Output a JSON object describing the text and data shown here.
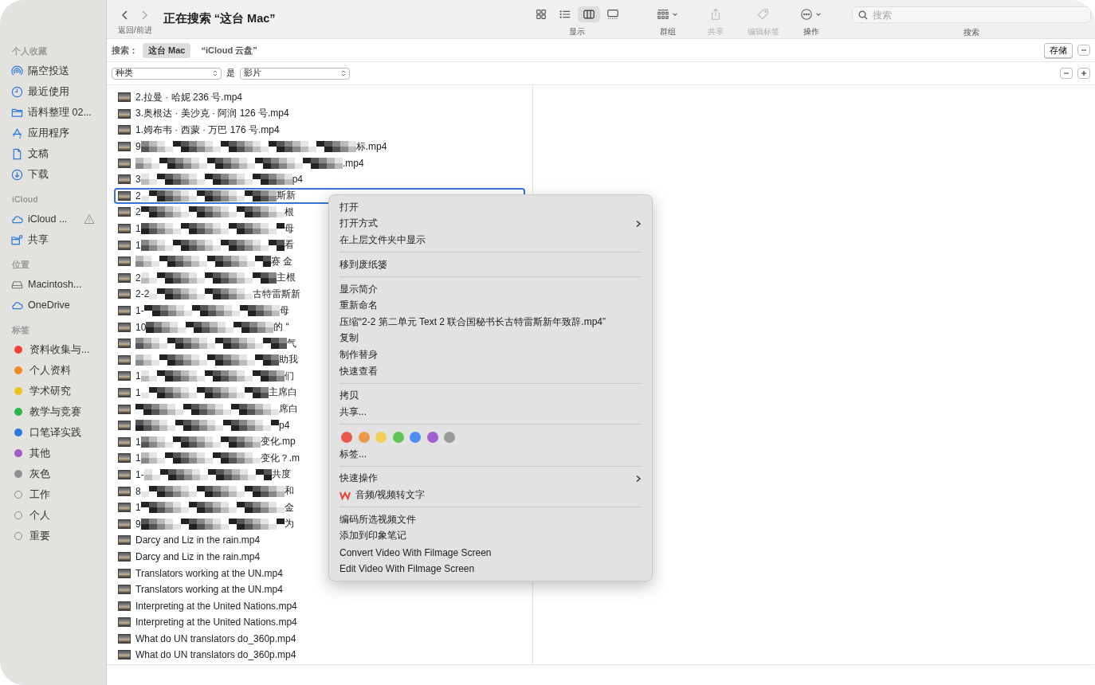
{
  "window": {
    "title": "正在搜索 “这台 Mac”",
    "nav_label": "返回/前进"
  },
  "sidebar": {
    "sections": [
      {
        "header": "个人收藏",
        "items": [
          {
            "label": "隔空投送",
            "warning": false
          },
          {
            "label": "最近使用",
            "warning": false
          },
          {
            "label": "语料整理 02...",
            "warning": false
          },
          {
            "label": "应用程序",
            "warning": false
          },
          {
            "label": "文稿",
            "warning": false
          },
          {
            "label": "下载",
            "warning": false
          }
        ]
      },
      {
        "header": "iCloud",
        "items": [
          {
            "label": "iCloud ...",
            "warning": true
          },
          {
            "label": "共享",
            "warning": false
          }
        ]
      },
      {
        "header": "位置",
        "items": [
          {
            "label": "Macintosh...",
            "warning": false
          },
          {
            "label": "OneDrive",
            "warning": false
          }
        ]
      },
      {
        "header": "标签",
        "items": [
          {
            "label": "资料收集与...",
            "color": "#f0443a"
          },
          {
            "label": "个人资料",
            "color": "#f08a24"
          },
          {
            "label": "学术研究",
            "color": "#e9c21c"
          },
          {
            "label": "教学与竞赛",
            "color": "#2fb449"
          },
          {
            "label": "口笔译实践",
            "color": "#2a7ae2"
          },
          {
            "label": "其他",
            "color": "#a45ac9"
          },
          {
            "label": "灰色",
            "color": "#8e8e93"
          },
          {
            "label": "工作"
          },
          {
            "label": "个人"
          },
          {
            "label": "重要"
          }
        ]
      }
    ]
  },
  "toolbar": {
    "view_buttons": [
      {
        "selected": false
      },
      {
        "selected": false
      },
      {
        "selected": true
      },
      {
        "selected": false
      }
    ],
    "view_label": "显示",
    "tools": [
      {
        "label": "群组",
        "disabled": false
      },
      {
        "label": "共享",
        "disabled": true
      },
      {
        "label": "编辑标签",
        "disabled": true
      },
      {
        "label": "操作",
        "disabled": false
      }
    ],
    "search": {
      "placeholder": "搜索",
      "label": "搜索"
    }
  },
  "scope_bar": {
    "label": "搜索：",
    "scopes": [
      {
        "label": "这台 Mac",
        "selected": true
      },
      {
        "label": "“iCloud 云盘”",
        "selected": false
      }
    ],
    "save_button": "存储"
  },
  "criteria": {
    "attribute": "种类",
    "operator": "是",
    "value": "影片"
  },
  "files": [
    {
      "kind": "plain",
      "name": "2.拉曼 · 哈妮 236 号.mp4",
      "selected": false
    },
    {
      "kind": "plain",
      "name": "3.奥根达 · 美沙克 · 阿润 126 号.mp4",
      "selected": false
    },
    {
      "kind": "plain",
      "name": "1.姆布韦 · 西蒙 · 万巴 176 号.mp4",
      "selected": false
    },
    {
      "kind": "pixelated",
      "prefix": "9",
      "suffix": "标.mp4",
      "selected": false
    },
    {
      "kind": "pixelated",
      "suffix": ".mp4",
      "selected": false
    },
    {
      "kind": "pixelated",
      "prefix": "3",
      "suffix": "p4",
      "selected": false
    },
    {
      "kind": "pixelated",
      "prefix": "2",
      "suffix": "斯新",
      "selected": true
    },
    {
      "kind": "pixelated",
      "prefix": "2",
      "suffix": "根",
      "selected": false
    },
    {
      "kind": "pixelated",
      "prefix": "1",
      "suffix": "母",
      "selected": false
    },
    {
      "kind": "pixelated",
      "prefix": "1",
      "suffix": "看",
      "selected": false
    },
    {
      "kind": "pixelated",
      "suffix": "赛 金",
      "selected": false
    },
    {
      "kind": "pixelated",
      "prefix": "2",
      "suffix": "主根",
      "selected": false
    },
    {
      "kind": "pixelated",
      "prefix": "2-2",
      "suffix": "古特雷斯新",
      "selected": false
    },
    {
      "kind": "pixelated",
      "prefix": "1-",
      "suffix": "母",
      "selected": false
    },
    {
      "kind": "pixelated",
      "prefix": "10",
      "suffix": "的 “",
      "selected": false
    },
    {
      "kind": "pixelated",
      "suffix": "气",
      "selected": false
    },
    {
      "kind": "pixelated",
      "suffix": "助我",
      "selected": false
    },
    {
      "kind": "pixelated",
      "prefix": "1",
      "suffix": "们",
      "selected": false
    },
    {
      "kind": "pixelated",
      "prefix": "1",
      "suffix": "主席白",
      "selected": false
    },
    {
      "kind": "pixelated",
      "suffix": "席白",
      "selected": false
    },
    {
      "kind": "pixelated",
      "suffix": "p4",
      "selected": false
    },
    {
      "kind": "pixelated",
      "prefix": "1",
      "suffix": "变化.mp",
      "selected": false
    },
    {
      "kind": "pixelated",
      "prefix": "1",
      "suffix": "变化？.m",
      "selected": false
    },
    {
      "kind": "pixelated",
      "prefix": "1-",
      "suffix": "共度",
      "selected": false
    },
    {
      "kind": "pixelated",
      "prefix": "8",
      "suffix": "和",
      "selected": false
    },
    {
      "kind": "pixelated",
      "prefix": "1",
      "suffix": "金",
      "selected": false
    },
    {
      "kind": "pixelated",
      "prefix": "9",
      "suffix": "为",
      "selected": false
    },
    {
      "kind": "plain",
      "name": "Darcy and Liz in the rain.mp4",
      "selected": false
    },
    {
      "kind": "plain",
      "name": "Darcy and Liz in the rain.mp4",
      "selected": false
    },
    {
      "kind": "plain",
      "name": "Translators working at the UN.mp4",
      "selected": false
    },
    {
      "kind": "plain",
      "name": "Translators working at the UN.mp4",
      "selected": false
    },
    {
      "kind": "plain",
      "name": "Interpreting at the United Nations.mp4",
      "selected": false
    },
    {
      "kind": "plain",
      "name": "Interpreting at the United Nations.mp4",
      "selected": false
    },
    {
      "kind": "plain",
      "name": "What do UN translators do_360p.mp4",
      "selected": false
    },
    {
      "kind": "plain",
      "name": "What do UN translators do_360p.mp4",
      "selected": false
    }
  ],
  "context_menu": [
    {
      "kind": "item",
      "label": "打开"
    },
    {
      "kind": "submenu",
      "label": "打开方式"
    },
    {
      "kind": "item",
      "label": "在上层文件夹中显示"
    },
    {
      "kind": "separator"
    },
    {
      "kind": "item",
      "label": "移到废纸篓"
    },
    {
      "kind": "separator"
    },
    {
      "kind": "item",
      "label": "显示简介"
    },
    {
      "kind": "item",
      "label": "重新命名"
    },
    {
      "kind": "item",
      "label": "压缩“2-2 第二单元 Text 2 联合国秘书长古特雷斯新年致辞.mp4”"
    },
    {
      "kind": "item",
      "label": "复制"
    },
    {
      "kind": "item",
      "label": "制作替身"
    },
    {
      "kind": "item",
      "label": "快速查看"
    },
    {
      "kind": "separator"
    },
    {
      "kind": "item",
      "label": "拷贝"
    },
    {
      "kind": "item",
      "label": "共享..."
    },
    {
      "kind": "separator"
    },
    {
      "kind": "tags",
      "colors": [
        {
          "color": "#e8594f"
        },
        {
          "color": "#ef9a4a"
        },
        {
          "color": "#f2cf56"
        },
        {
          "color": "#5fc454"
        },
        {
          "color": "#4d8ef0"
        },
        {
          "color": "#a25fd0"
        },
        {
          "color": "#9a9a9c"
        }
      ]
    },
    {
      "kind": "item",
      "label": "标签..."
    },
    {
      "kind": "separator"
    },
    {
      "kind": "submenu",
      "label": "快速操作"
    },
    {
      "kind": "app",
      "label": "音频/视频转文字"
    },
    {
      "kind": "separator"
    },
    {
      "kind": "item",
      "label": "编码所选视频文件"
    },
    {
      "kind": "item",
      "label": "添加到印象笔记"
    },
    {
      "kind": "item",
      "label": "Convert Video With Filmage Screen"
    },
    {
      "kind": "item",
      "label": "Edit Video With Filmage Screen"
    }
  ]
}
